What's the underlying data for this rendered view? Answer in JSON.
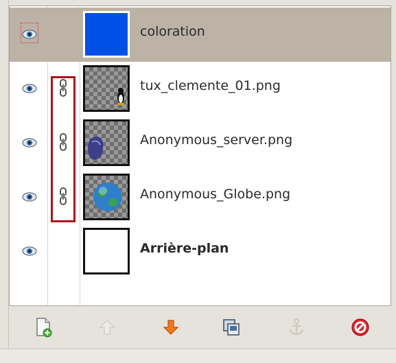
{
  "layers_panel": {
    "layers": [
      {
        "name": "coloration",
        "visible": true,
        "linked": false,
        "selected": true,
        "thumb": "solid-blue",
        "bold": false
      },
      {
        "name": "tux_clemente_01.png",
        "visible": true,
        "linked": true,
        "selected": false,
        "thumb": "transparent-tux",
        "bold": false
      },
      {
        "name": "Anonymous_server.png",
        "visible": true,
        "linked": true,
        "selected": false,
        "thumb": "transparent-server",
        "bold": false
      },
      {
        "name": "Anonymous_Globe.png",
        "visible": true,
        "linked": true,
        "selected": false,
        "thumb": "transparent-globe",
        "bold": false
      },
      {
        "name": "Arrière-plan",
        "visible": true,
        "linked": false,
        "selected": false,
        "thumb": "white",
        "bold": true
      }
    ]
  },
  "toolbar": {
    "buttons": [
      {
        "icon": "new-layer-icon",
        "enabled": true
      },
      {
        "icon": "raise-layer-icon",
        "enabled": false
      },
      {
        "icon": "lower-layer-icon",
        "enabled": true
      },
      {
        "icon": "duplicate-layer-icon",
        "enabled": true
      },
      {
        "icon": "anchor-layer-icon",
        "enabled": false
      },
      {
        "icon": "delete-layer-icon",
        "enabled": true
      }
    ]
  },
  "colors": {
    "selected_row": "#bcb2a6",
    "highlight_frame": "#b0121b",
    "blue_layer": "#0050e8"
  }
}
